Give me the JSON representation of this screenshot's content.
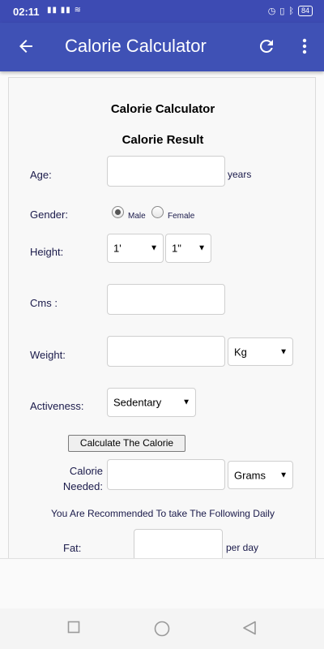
{
  "status": {
    "time": "02:11",
    "signal": "▮▮ ▮▮",
    "battery": "84"
  },
  "appbar": {
    "title": "Calorie Calculator"
  },
  "form": {
    "heading": "Calorie Calculator",
    "result_heading": "Calorie Result",
    "age_label": "Age:",
    "age_value": "",
    "age_unit": "years",
    "gender_label": "Gender:",
    "gender_male": "Male",
    "gender_female": "Female",
    "gender_selected": "Male",
    "height_label": "Height:",
    "height_feet": "1'",
    "height_inches": "1\"",
    "cms_label": "Cms :",
    "cms_value": "",
    "weight_label": "Weight:",
    "weight_value": "",
    "weight_unit": "Kg",
    "activeness_label": "Activeness:",
    "activeness_value": "Sedentary",
    "calculate_button": "Calculate The Calorie",
    "calorie_needed_label_1": "Calorie",
    "calorie_needed_label_2": "Needed:",
    "calorie_needed_value": "",
    "calorie_unit": "Grams",
    "recommend_text": "You Are Recommended To take The Following Daily",
    "fat_label": "Fat:",
    "fat_value": "",
    "fat_unit": "per day"
  },
  "colors": {
    "appbar": "#3f51b5",
    "statusbar": "#3d4bb3",
    "label": "#1a1a4a"
  }
}
